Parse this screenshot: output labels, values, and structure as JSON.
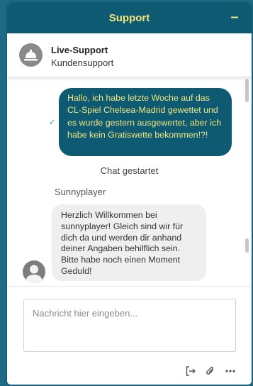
{
  "header": {
    "title": "Support",
    "minimize_label": "–"
  },
  "agent": {
    "name": "Live-Support",
    "department": "Kundensupport"
  },
  "chat": {
    "messages": [
      {
        "from": "user",
        "text": "Hallo, ich habe letzte Woche auf das CL-Spiel Chelsea-Madrid gewettet und es wurde gestern ausgewertet, aber ich habe kein Gratiswette bekommen!?!",
        "status_icon": "check-icon"
      },
      {
        "from": "system",
        "text": "Chat gestartet"
      },
      {
        "from": "agent",
        "sender": "Sunnyplayer",
        "text": "Herzlich Willkommen bei sunnyplayer! Gleich sind wir für dich da und werden dir anhand deiner Angaben behilflich sein. Bitte habe noch einen Moment Geduld!"
      }
    ]
  },
  "composer": {
    "placeholder": "Nachricht hier eingeben...",
    "actions": [
      "exit-chat-icon",
      "paperclip-icon",
      "more-options-icon"
    ]
  },
  "colors": {
    "brand": "#0f5a73",
    "accent_text": "#f2e57a",
    "background": "#1d6a84"
  }
}
